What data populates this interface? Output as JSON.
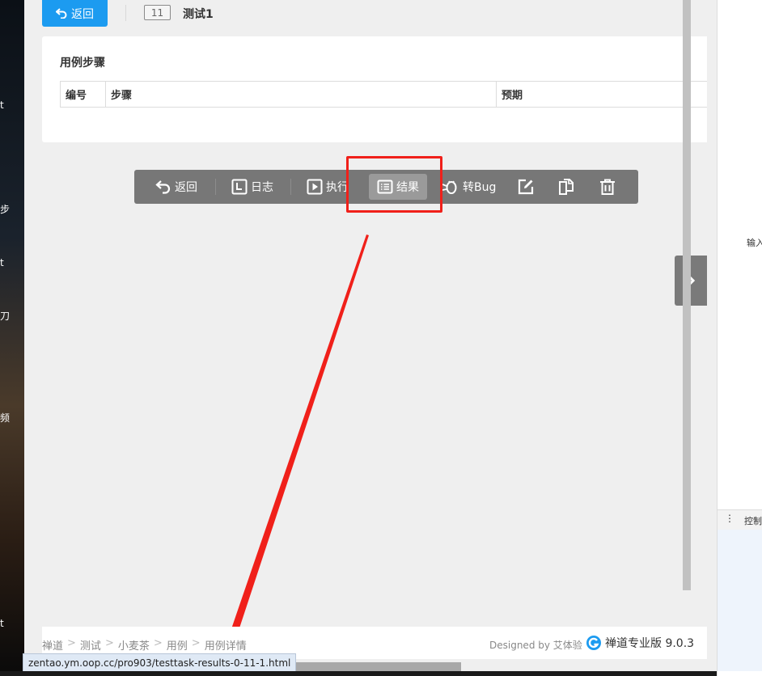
{
  "header": {
    "back_label": "返回",
    "case_id": "11",
    "title": "测试1"
  },
  "steps": {
    "heading": "用例步骤",
    "columns": [
      "编号",
      "步骤",
      "预期"
    ]
  },
  "actions": {
    "back": "返回",
    "log": "日志",
    "run": "执行",
    "results": "结果",
    "to_bug": "转Bug"
  },
  "footer": {
    "breadcrumbs": [
      "禅道",
      "测试",
      "小麦茶",
      "用例",
      "用例详情"
    ],
    "crumb_sep": ">",
    "designed_by": "Designed by 艾体验",
    "product": "禅道专业版 9.0.3"
  },
  "status_url": "zentao.ym.oop.cc/pro903/testtask-results-0-11-1.html",
  "side_panel": {
    "input_label": "输入",
    "console_label": "控制"
  },
  "desktop_fragments": [
    "t",
    "步",
    "t",
    "刀",
    "频",
    "t"
  ],
  "colors": {
    "primary": "#1c9bf0",
    "annotation": "#f0201a",
    "action_bar": "#777777"
  }
}
